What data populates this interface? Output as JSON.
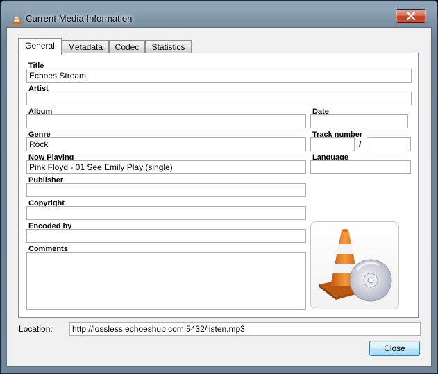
{
  "window": {
    "title": "Current Media Information",
    "close_glyph": "✕"
  },
  "tabs": [
    "General",
    "Metadata",
    "Codec",
    "Statistics"
  ],
  "active_tab": "General",
  "fields": {
    "title_label": "Title",
    "title_value": "Echoes Stream",
    "artist_label": "Artist",
    "artist_value": "",
    "album_label": "Album",
    "album_value": "",
    "date_label": "Date",
    "date_value": "",
    "genre_label": "Genre",
    "genre_value": "Rock",
    "track_label": "Track number",
    "track_value": "",
    "track_total_value": "",
    "track_separator": "/",
    "now_playing_label": "Now Playing",
    "now_playing_value": "Pink Floyd - 01  See Emily Play (single)",
    "language_label": "Language",
    "language_value": "",
    "publisher_label": "Publisher",
    "publisher_value": "",
    "copyright_label": "Copyright",
    "copyright_value": "",
    "encoded_by_label": "Encoded by",
    "encoded_by_value": "",
    "comments_label": "Comments",
    "comments_value": ""
  },
  "artwork": {
    "icon": "vlc-cone-with-disc-icon"
  },
  "location": {
    "label": "Location:",
    "value": "http://lossless.echoeshub.com:5432/listen.mp3"
  },
  "buttons": {
    "close_label": "Close"
  },
  "colors": {
    "accent": "#3c7fb1",
    "close_red": "#c03d20",
    "cone_orange": "#e8751a"
  }
}
